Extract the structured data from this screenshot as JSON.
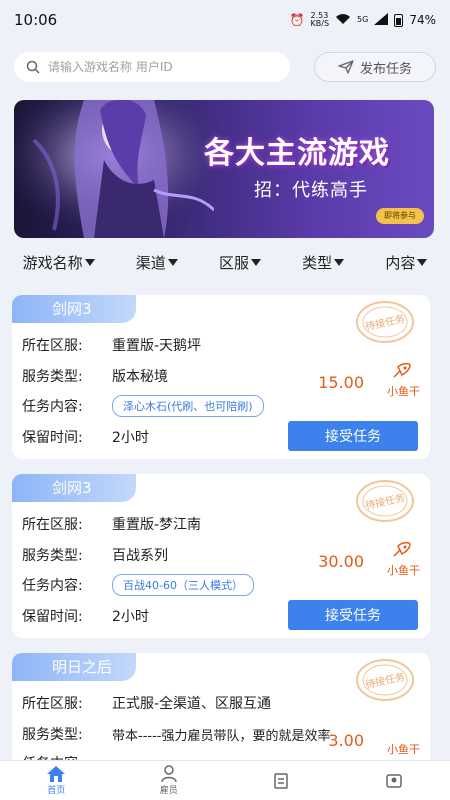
{
  "status": {
    "time": "10:06",
    "speed": "2.53",
    "speed_unit": "KB/S",
    "network": "5G",
    "battery": "74%"
  },
  "search": {
    "placeholder": "请输入游戏名称 用户ID",
    "publish_label": "发布任务"
  },
  "banner": {
    "title": "各大主流游戏",
    "subtitle": "招：代练高手",
    "button": "即将参与"
  },
  "filters": [
    "游戏名称",
    "渠道",
    "区服",
    "类型",
    "内容"
  ],
  "labels": {
    "region": "所在区服:",
    "service": "服务类型:",
    "content": "任务内容:",
    "keep": "保留时间:",
    "accept": "接受任务",
    "unit": "小鱼干",
    "stamp": "待接任务"
  },
  "tasks": [
    {
      "game": "剑网3",
      "region": "重置版-天鹅坪",
      "service": "版本秘境",
      "content": "泽心木石(代刷、也可陪刷)",
      "price": "15.00",
      "keep": "2小时"
    },
    {
      "game": "剑网3",
      "region": "重置版-梦江南",
      "service": "百战系列",
      "content": "百战40-60（三人模式）",
      "price": "30.00",
      "keep": "2小时"
    },
    {
      "game": "明日之后",
      "region": "正式服-全渠道、区服互通",
      "service": "带本-----强力雇员带队，要的就是效率",
      "content": "",
      "price": "3.00",
      "keep": ""
    }
  ],
  "nav": [
    {
      "label": "首页",
      "icon": "home-icon"
    },
    {
      "label": "雇员",
      "icon": "user-icon"
    },
    {
      "label": "",
      "icon": "task-icon"
    },
    {
      "label": "",
      "icon": "profile-icon"
    }
  ],
  "colors": {
    "accent": "#3d82ec",
    "price": "#e55a17",
    "tag": "#8db5f6"
  }
}
